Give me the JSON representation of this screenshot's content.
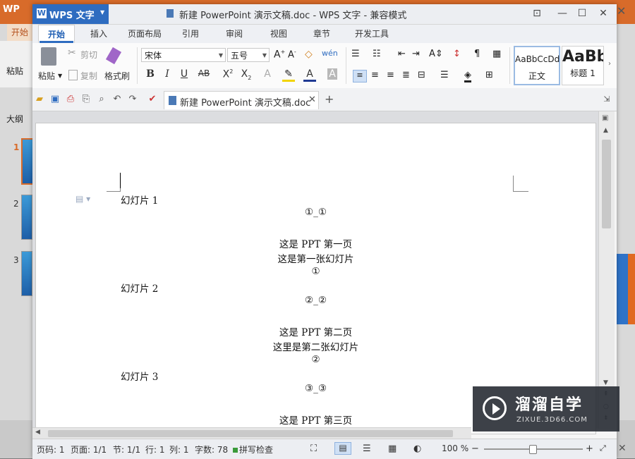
{
  "background_app": {
    "title_fragment": "WP",
    "tab_fragment": "开始",
    "paste_fragment": "粘贴",
    "panel_label": "大纲",
    "slide_numbers": [
      "1",
      "2",
      "3"
    ]
  },
  "window": {
    "app_name": "WPS 文字",
    "title": "新建 PowerPoint 演示文稿.doc - WPS 文字 - 兼容模式"
  },
  "ribbon_tabs": [
    "开始",
    "插入",
    "页面布局",
    "引用",
    "审阅",
    "视图",
    "章节",
    "开发工具"
  ],
  "ribbon": {
    "paste": "粘贴",
    "cut": "剪切",
    "copy": "复制",
    "format_painter": "格式刷",
    "font_name": "宋体",
    "font_size": "五号",
    "styles": [
      {
        "preview": "AaBbCcDd",
        "name": "正文"
      },
      {
        "preview": "AaBb",
        "name": "标题 1"
      }
    ]
  },
  "doc_tab": {
    "label": "新建 PowerPoint 演示文稿.doc"
  },
  "document": {
    "lines": [
      "幻灯片 1",
      "①_①",
      "这是 PPT 第一页",
      "这是第一张幻灯片",
      "①",
      "幻灯片 2",
      "②_②",
      "这是 PPT 第二页",
      "这里是第二张幻灯片",
      "②",
      "幻灯片 3",
      "③_③",
      "这是 PPT 第三页"
    ]
  },
  "status": {
    "page_code": "页码: 1",
    "pages": "页面: 1/1",
    "section": "节: 1/1",
    "row": "行: 1",
    "col": "列: 1",
    "word_count": "字数: 78",
    "spell_check": "拼写检查",
    "zoom": "100 %"
  },
  "watermark": {
    "name": "溜溜自学",
    "url": "ZIXUE.3D66.COM"
  },
  "colors": {
    "accent": "#2e6cc0",
    "ppt_orange": "#d86b2a"
  }
}
